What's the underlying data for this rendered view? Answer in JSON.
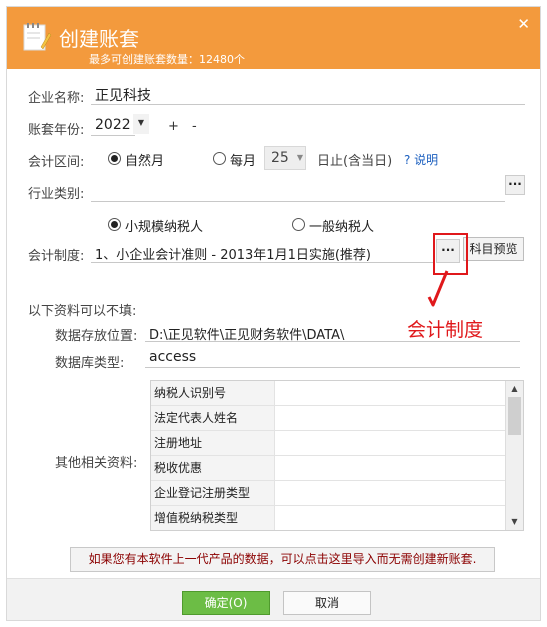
{
  "title": "创建账套",
  "subtitle": "最多可创建账套数量：12480个",
  "company": {
    "label": "企业名称:",
    "value": "正见科技"
  },
  "year": {
    "label": "账套年份:",
    "value": "2022",
    "plus": "+",
    "minus": "-"
  },
  "period": {
    "label": "会计区间:",
    "natural_month": "自然月",
    "monthly": "每月",
    "day": "25",
    "day_suffix": "日止(含当日)",
    "help": "? 说明"
  },
  "industry": {
    "label": "行业类别:",
    "value": ""
  },
  "taxpayer": {
    "small": "小规模纳税人",
    "general": "一般纳税人"
  },
  "accounting_system": {
    "label": "会计制度:",
    "value": "1、小企业会计准则 - 2013年1月1日实施(推荐)",
    "preview_button": "科目预览"
  },
  "optional_header": "以下资料可以不填:",
  "storage": {
    "label": "数据存放位置:",
    "value": "D:\\正见软件\\正见财务软件\\DATA\\"
  },
  "database": {
    "label": "数据库类型:",
    "value": "access"
  },
  "other_info": {
    "label": "其他相关资料:",
    "rows": [
      "纳税人识别号",
      "法定代表人姓名",
      "注册地址",
      "税收优惠",
      "企业登记注册类型",
      "增值税纳税类型"
    ]
  },
  "notice": "如果您有本软件上一代产品的数据，可以点击这里导入而无需创建新账套.",
  "buttons": {
    "ok": "确定(O)",
    "cancel": "取消"
  },
  "annotation": {
    "label": "会计制度"
  },
  "icons": {
    "close": "close-icon",
    "dots": "ellipsis-icon",
    "app": "notebook-pencil-icon"
  },
  "colors": {
    "title_bar": "#f39a3d",
    "ok_button": "#6cbd45",
    "annotation": "#e0181b",
    "notice_text": "#8b0000",
    "help_link": "#1b5fbf"
  }
}
